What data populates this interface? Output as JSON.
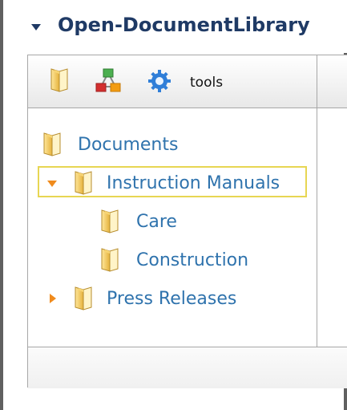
{
  "window": {
    "title": "Open-DocumentLibrary"
  },
  "toolbar": {
    "tools_label": "tools",
    "icons": [
      "folder-icon",
      "network-icon",
      "gear-icon"
    ]
  },
  "tree": {
    "root": {
      "label": "Documents"
    },
    "items": [
      {
        "label": "Instruction Manuals",
        "expanded": true,
        "selected": true
      },
      {
        "label": "Care"
      },
      {
        "label": "Construction"
      },
      {
        "label": "Press Releases",
        "expanded": false
      }
    ]
  },
  "colors": {
    "title_text": "#1f3a65",
    "tree_text": "#2f73ad",
    "selection_outline": "#e7d653",
    "border": "#a7a7a7",
    "folder": "#f0c34c",
    "network_red": "#d32f2f",
    "network_green": "#4caf50",
    "network_orange": "#f39c12",
    "gear_blue": "#2f7ed8"
  }
}
